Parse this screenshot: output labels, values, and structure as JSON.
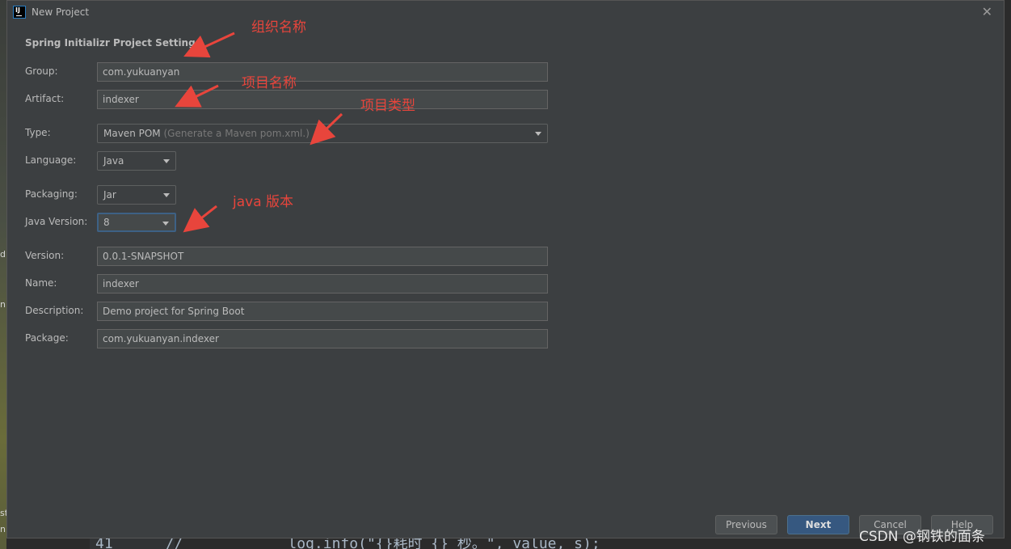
{
  "window": {
    "title": "New Project",
    "close": "✕"
  },
  "section_title": "Spring Initializr Project Settings",
  "fields": {
    "group": {
      "label": "Group:",
      "value": "com.yukuanyan"
    },
    "artifact": {
      "label": "Artifact:",
      "value": "indexer"
    },
    "type": {
      "label": "Type:",
      "value": "Maven POM",
      "hint": "(Generate a Maven pom.xml.)"
    },
    "language": {
      "label": "Language:",
      "value": "Java"
    },
    "packaging": {
      "label": "Packaging:",
      "value": "Jar"
    },
    "java_version": {
      "label": "Java Version:",
      "value": "8"
    },
    "version": {
      "label": "Version:",
      "value": "0.0.1-SNAPSHOT"
    },
    "name": {
      "label": "Name:",
      "value": "indexer"
    },
    "description": {
      "label": "Description:",
      "value": "Demo project for Spring Boot"
    },
    "package": {
      "label": "Package:",
      "value": "com.yukuanyan.indexer"
    }
  },
  "buttons": {
    "previous": "Previous",
    "next": "Next",
    "cancel": "Cancel",
    "help": "Help"
  },
  "annotations": {
    "group_name": "组织名称",
    "project_name": "项目名称",
    "project_type": "项目类型",
    "java_version": "java 版本"
  },
  "background": {
    "code_line": "41      //            log.info(\"{}耗时 {} 秒。\", value, s);",
    "side_chars": [
      "d",
      "n",
      "st",
      "n"
    ]
  },
  "watermark": "CSDN @钢铁的面条",
  "colors": {
    "annotation": "#e8453c",
    "dialog_bg": "#3c3f41",
    "primary_button": "#365880",
    "focus_border": "#3d6185"
  }
}
